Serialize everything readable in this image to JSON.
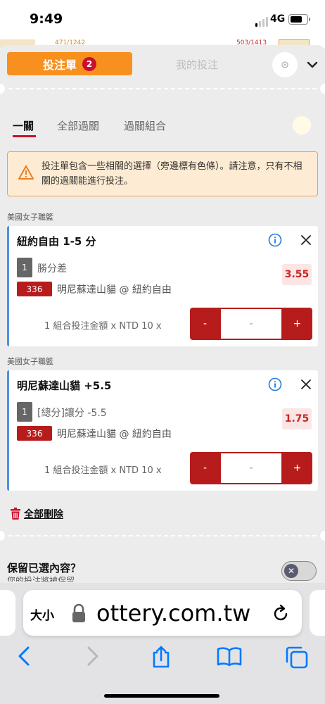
{
  "status_bar": {
    "time": "9:49",
    "network": "4G"
  },
  "peek": {
    "left_text": "471/1242",
    "right_text": "503/1413"
  },
  "header": {
    "bet_slip_tab": "投注單",
    "bet_count": "2",
    "my_bets_tab": "我的投注"
  },
  "sub_tabs": [
    "一關",
    "全部過關",
    "過關組合"
  ],
  "warning": {
    "text": "投注單包含一些相關的選擇（旁邊標有色條）。請注意，只有不相關的過關能進行投注。"
  },
  "bets": [
    {
      "league": "美國女子職籃",
      "title": "紐約自由 1-5 分",
      "leg_number": "1",
      "market": "勝分差",
      "odds": "3.55",
      "code": "336",
      "match": "明尼蘇達山貓 @ 紐約自由",
      "stake_label": "1 組合投注金額 x NTD 10 x",
      "minus": "-",
      "amount": "-",
      "plus": "+"
    },
    {
      "league": "美國女子職籃",
      "title": "明尼蘇達山貓 +5.5",
      "leg_number": "1",
      "market": "[總分]讓分 -5.5",
      "odds": "1.75",
      "code": "336",
      "match": "明尼蘇達山貓 @ 紐約自由",
      "stake_label": "1 組合投注金額 x NTD 10 x",
      "minus": "-",
      "amount": "-",
      "plus": "+"
    }
  ],
  "delete_all": "全部刪除",
  "keep_selections": {
    "title": "保留已選內容？",
    "subtitle": "您的投注將被保留"
  },
  "browser": {
    "text_size": "大小",
    "url": "ottery.com.tw"
  },
  "colors": {
    "accent": "#f7901e",
    "brand_red": "#b71c1c",
    "link_blue": "#4a90e2",
    "ios_blue": "#007aff"
  }
}
